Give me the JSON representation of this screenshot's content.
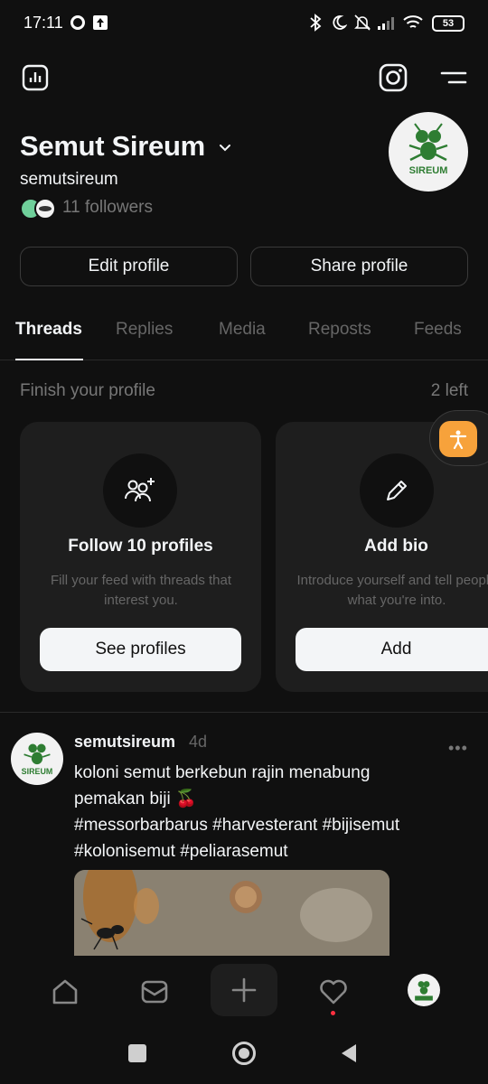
{
  "status_bar": {
    "time": "17:11",
    "battery": "53"
  },
  "profile": {
    "display_name": "Semut Sireum",
    "username": "semutsireum",
    "followers": "11 followers",
    "avatar_text": "SIREUM"
  },
  "buttons": {
    "edit_profile": "Edit profile",
    "share_profile": "Share profile"
  },
  "tabs": [
    {
      "label": "Threads",
      "active": true
    },
    {
      "label": "Replies"
    },
    {
      "label": "Media"
    },
    {
      "label": "Reposts"
    },
    {
      "label": "Feeds"
    }
  ],
  "finish_profile": {
    "title": "Finish your profile",
    "remaining": "2 left",
    "cards": [
      {
        "icon": "add-people-icon",
        "title": "Follow 10 profiles",
        "description": "Fill your feed with threads that interest you.",
        "button": "See profiles"
      },
      {
        "icon": "pencil-icon",
        "title": "Add bio",
        "description": "Introduce yourself and tell people what you're into.",
        "button": "Add"
      }
    ]
  },
  "post": {
    "username": "semutsireum",
    "time": "4d",
    "line1": "koloni semut berkebun rajin menabung",
    "line2": "pemakan biji 🍒",
    "line3": "#messorbarbarus #harvesterant #bijisemut",
    "line4": "#kolonisemut #peliarasemut"
  },
  "colors": {
    "background": "#101010",
    "card": "#1e1e1e",
    "accent_orange": "#f7a23b",
    "notification_dot": "#ff3040"
  }
}
